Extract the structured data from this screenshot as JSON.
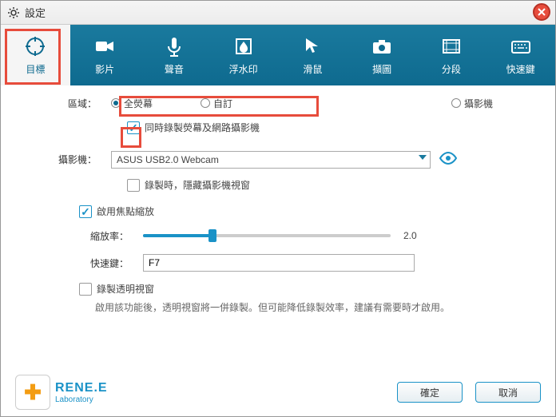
{
  "title": "設定",
  "tabs": [
    {
      "label": "目標"
    },
    {
      "label": "影片"
    },
    {
      "label": "聲音"
    },
    {
      "label": "浮水印"
    },
    {
      "label": "滑鼠"
    },
    {
      "label": "擷圖"
    },
    {
      "label": "分段"
    },
    {
      "label": "快速鍵"
    }
  ],
  "region": {
    "label": "區域：",
    "fullscreen": "全熒幕",
    "custom": "自訂",
    "camera": "攝影機"
  },
  "simul": "同時錄製熒幕及網路攝影機",
  "webcam": {
    "label": "攝影機：",
    "value": "ASUS USB2.0 Webcam"
  },
  "hide_cam": "錄製時，隱藏攝影機視窗",
  "focus_zoom": "啟用焦點縮放",
  "zoom": {
    "label": "縮放率：",
    "value": "2.0"
  },
  "hotkey": {
    "label": "快速鍵：",
    "value": "F7"
  },
  "transparent": {
    "label": "錄製透明視窗",
    "desc": "啟用該功能後，透明視窗將一併錄製。但可能降低錄製效率，建議有需要時才啟用。"
  },
  "footer": {
    "brand": "RENE.E",
    "sub": "Laboratory",
    "ok": "確定",
    "cancel": "取消"
  }
}
